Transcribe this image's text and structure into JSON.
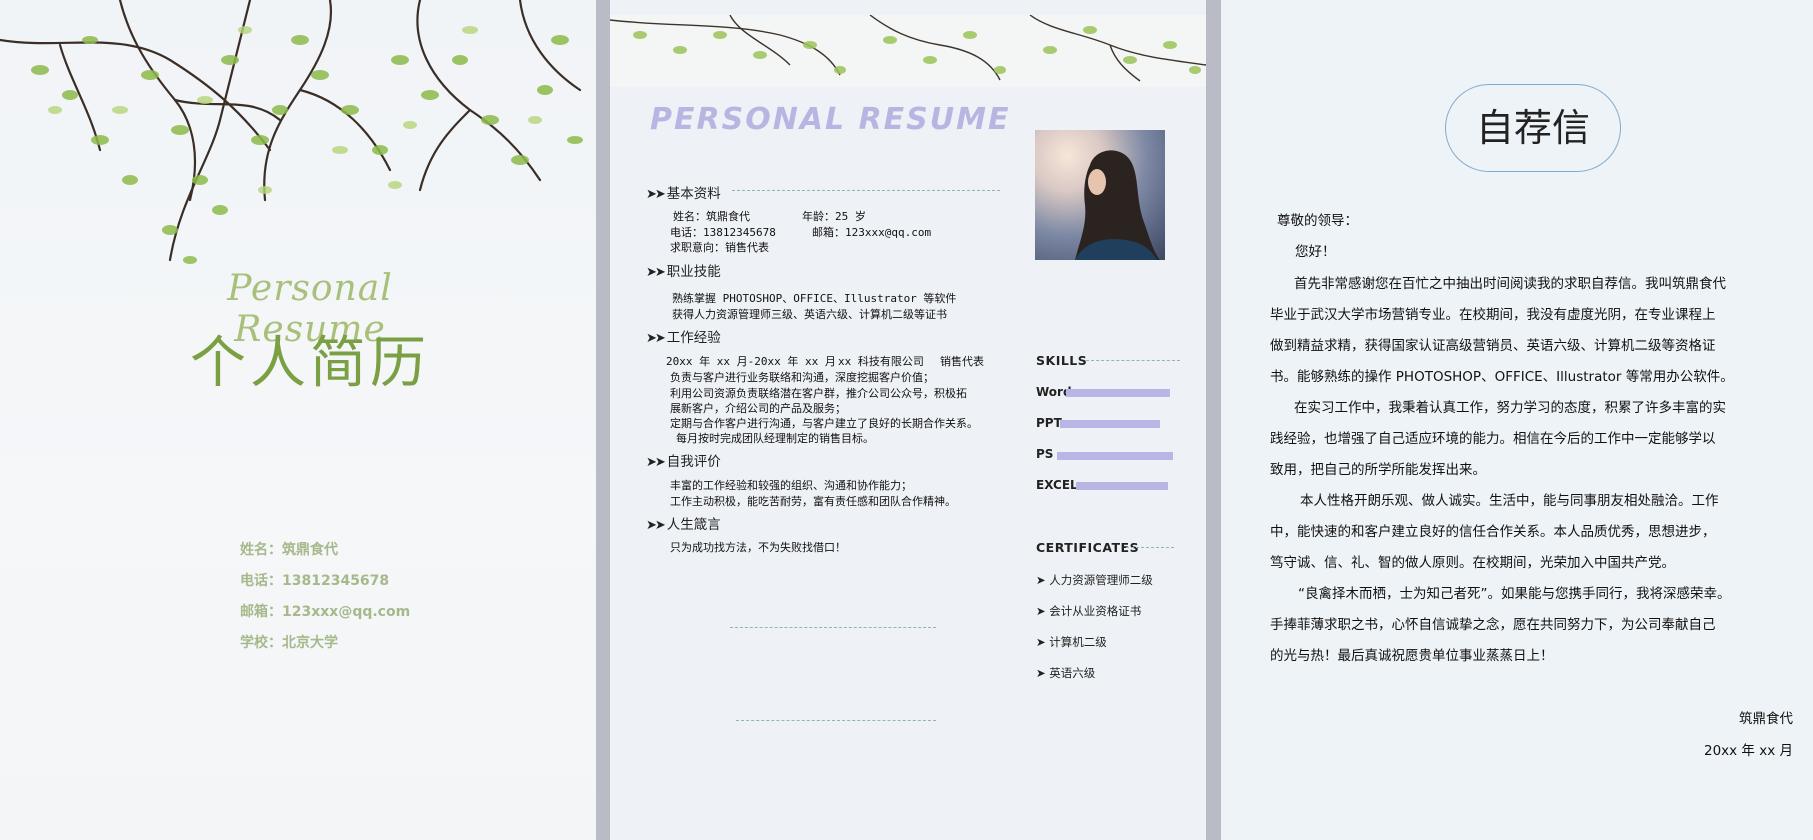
{
  "cover": {
    "script_title": "Personal Resume",
    "title": "个人简历",
    "info": [
      "姓名：筑鼎食代",
      "电话：13812345678",
      "邮箱：123xxx@qq.com",
      "学校：北京大学"
    ]
  },
  "resume": {
    "title": "PERSONAL RESUME",
    "sections": {
      "basic": "基本资料",
      "skills": "职业技能",
      "experience": "工作经验",
      "evaluation": "自我评价",
      "motto": "人生箴言"
    },
    "basic": {
      "name": "姓名：筑鼎食代",
      "age": "年龄：25 岁",
      "phone": "电话：13812345678",
      "email": "邮箱：123xxx@qq.com",
      "intent": "求职意向：销售代表"
    },
    "skills_text": [
      "熟练掌握 PHOTOSHOP、OFFICE、Illustrator 等软件",
      "获得人力资源管理师三级、英语六级、计算机二级等证书"
    ],
    "experience": {
      "period": "20xx 年 xx 月-20xx 年 xx 月",
      "company": "xx 科技有限公司",
      "role": "销售代表",
      "lines": [
        "负责与客户进行业务联络和沟通，深度挖掘客户价值；",
        "利用公司资源负责联络潜在客户群，推介公司公众号，积极拓",
        "展新客户，介绍公司的产品及服务；",
        "定期与合作客户进行沟通，与客户建立了良好的长期合作关系。",
        "每月按时完成团队经理制定的销售目标。"
      ]
    },
    "evaluation": [
      "丰富的工作经验和较强的组织、沟通和协作能力；",
      "工作主动积极，能吃苦耐劳，富有责任感和团队合作精神。"
    ],
    "motto": "只为成功找方法，不为失败找借口！",
    "skills_heading": "SKILLS",
    "skills": [
      {
        "name": "Word",
        "level": 0.85
      },
      {
        "name": "PPT",
        "level": 0.82
      },
      {
        "name": "PS",
        "level": 0.95
      },
      {
        "name": "EXCEL",
        "level": 0.75
      }
    ],
    "certificates_heading": "CERTIFICATES",
    "certificates": [
      "人力资源管理师二级",
      "会计从业资格证书",
      "计算机二级",
      "英语六级"
    ],
    "accent_color": "#b8b6e4"
  },
  "letter": {
    "title": "自荐信",
    "salutation": "尊敬的领导：",
    "greeting": "您好！",
    "lines": [
      "首先非常感谢您在百忙之中抽出时间阅读我的求职自荐信。我叫筑鼎食代",
      "毕业于武汉大学市场营销专业。在校期间，我没有虚度光阴，在专业课程上",
      "做到精益求精，获得国家认证高级营销员、英语六级、计算机二级等资格证",
      "书。能够熟练的操作 PHOTOSHOP、OFFICE、Illustrator 等常用办公软件。",
      "在实习工作中，我秉着认真工作，努力学习的态度，积累了许多丰富的实",
      "践经验，也增强了自己适应环境的能力。相信在今后的工作中一定能够学以",
      "致用，把自己的所学所能发挥出来。",
      "本人性格开朗乐观、做人诚实。生活中，能与同事朋友相处融洽。工作",
      "中，能快速的和客户建立良好的信任合作关系。本人品质优秀，思想进步，",
      "笃守诚、信、礼、智的做人原则。在校期间，光荣加入中国共产党。",
      "“良禽择木而栖，士为知己者死”。如果能与您携手同行，我将深感荣幸。",
      "手捧菲薄求职之书，心怀自信诚挚之念，愿在共同努力下，为公司奉献自己",
      "的光与热！最后真诚祝愿贵单位事业蒸蒸日上！"
    ],
    "signature": "筑鼎食代",
    "date": "20xx 年 xx 月"
  }
}
